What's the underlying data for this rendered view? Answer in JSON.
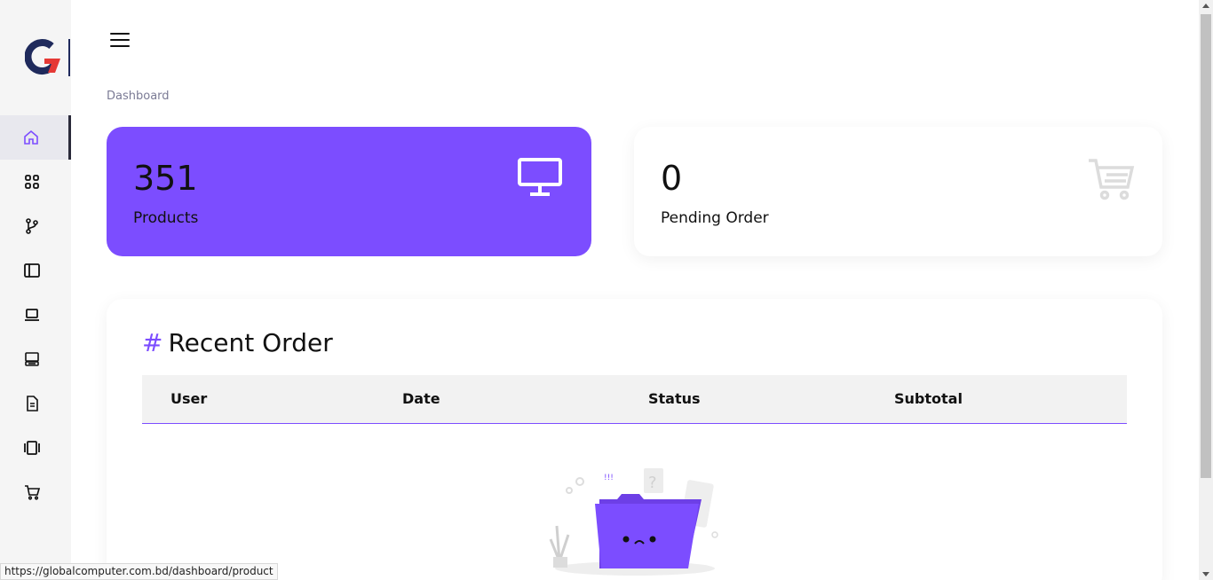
{
  "app": {
    "logo_letter": "G"
  },
  "sidebar": {
    "items": [
      {
        "icon": "home-icon",
        "active": true
      },
      {
        "icon": "grid-icon",
        "active": false
      },
      {
        "icon": "git-branch-icon",
        "active": false
      },
      {
        "icon": "layout-sidebar-icon",
        "active": false
      },
      {
        "icon": "laptop-icon",
        "active": false
      },
      {
        "icon": "server-icon",
        "active": false
      },
      {
        "icon": "document-icon",
        "active": false
      },
      {
        "icon": "gallery-icon",
        "active": false
      },
      {
        "icon": "cart-icon",
        "active": false
      }
    ]
  },
  "header": {
    "breadcrumb": "Dashboard"
  },
  "cards": {
    "products": {
      "count": "351",
      "label": "Products",
      "icon": "monitor-icon"
    },
    "pending": {
      "count": "0",
      "label": "Pending Order",
      "icon": "cart-icon"
    }
  },
  "recent_order": {
    "hash": "#",
    "title": "Recent Order",
    "columns": [
      "User",
      "Date",
      "Status",
      "Subtotal"
    ],
    "rows": []
  },
  "status_bar": {
    "url": "https://globalcomputer.com.bd/dashboard/product"
  },
  "colors": {
    "accent": "#7c4dff",
    "brand_red": "#e53935",
    "brand_navy": "#1f2a5c"
  }
}
